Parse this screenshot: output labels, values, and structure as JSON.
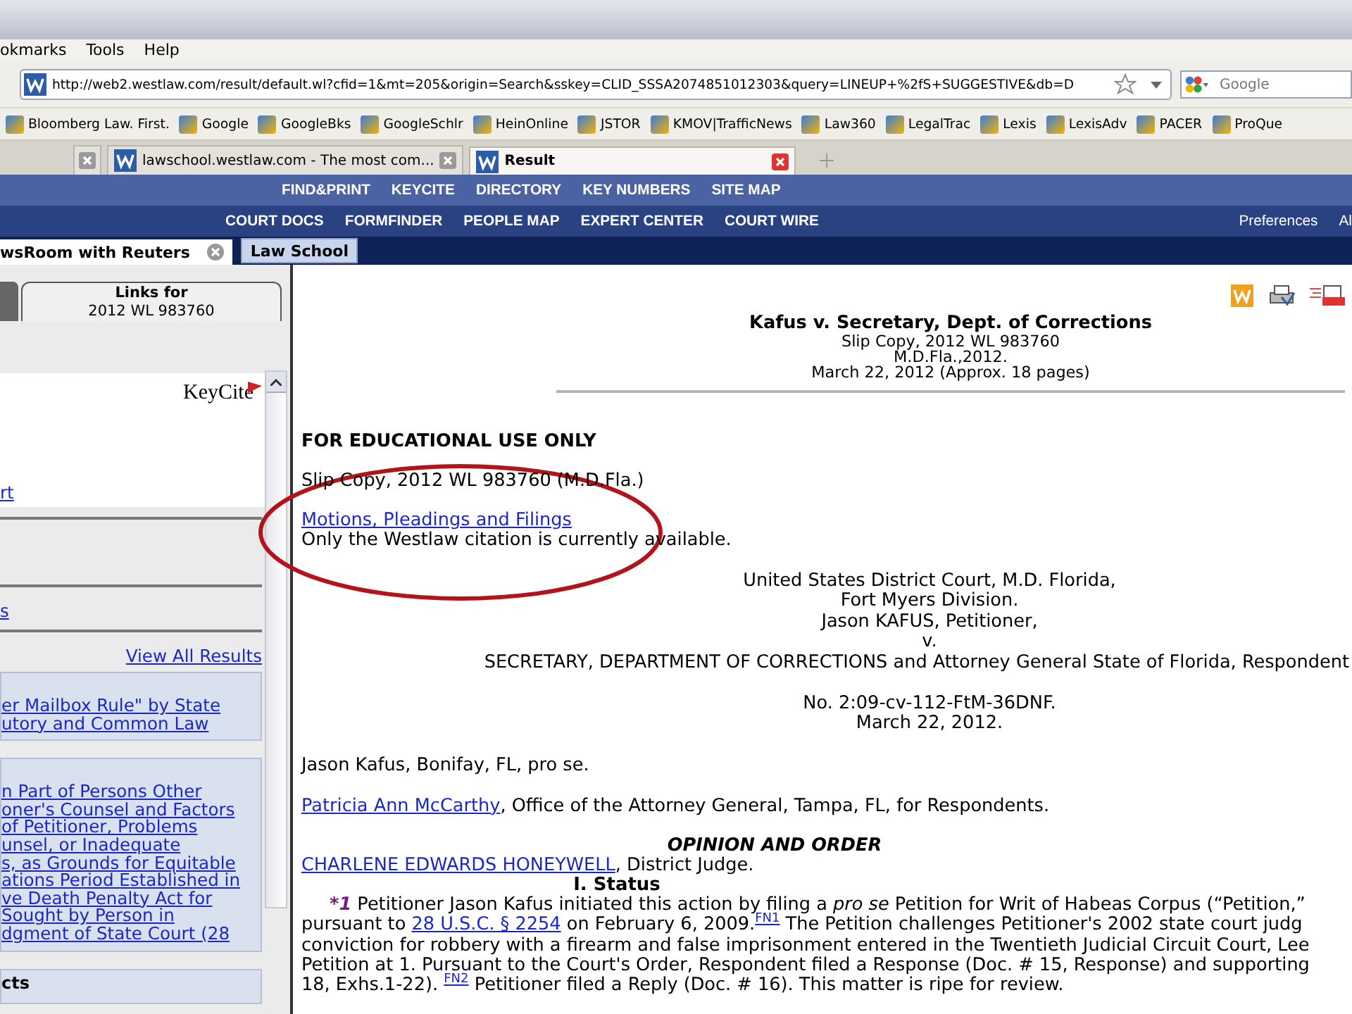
{
  "browser": {
    "menu": [
      "okmarks",
      "Tools",
      "Help"
    ],
    "url": "http://web2.westlaw.com/result/default.wl?cfid=1&mt=205&origin=Search&sskey=CLID_SSSA2074851012303&query=LINEUP+%2fS+SUGGESTIVE&db=D",
    "search_placeholder": "Google",
    "bookmarks": [
      "Bloomberg Law. First.",
      "Google",
      "GoogleBks",
      "GoogleSchlr",
      "HeinOnline",
      "JSTOR",
      "KMOV|TrafficNews",
      "Law360",
      "LegalTrac",
      "Lexis",
      "LexisAdv",
      "PACER",
      "ProQue"
    ],
    "tabs": [
      {
        "selected": false
      },
      {
        "label": "lawschool.westlaw.com - The most com...",
        "selected": false
      },
      {
        "label": "Result",
        "selected": true
      }
    ]
  },
  "site": {
    "nav_primary": [
      "FIND&PRINT",
      "KEYCITE",
      "DIRECTORY",
      "KEY NUMBERS",
      "SITE MAP"
    ],
    "nav_secondary": [
      "COURT DOCS",
      "FORMFINDER",
      "PEOPLE MAP",
      "EXPERT CENTER",
      "COURT WIRE"
    ],
    "nav_right": [
      "Preferences",
      "Al"
    ],
    "tabs": [
      {
        "label": "wsRoom with Reuters",
        "closable": true
      },
      {
        "label": "Law School",
        "closable": false
      }
    ]
  },
  "sidebar": {
    "tab_title": "Links for",
    "tab_subtitle": "2012 WL 983760",
    "logo": "KeyCite",
    "link_1": "rt",
    "link_2": "s",
    "view_all": "View All Results",
    "result_boxes": [
      {
        "lines": [
          "er Mailbox Rule\" by State",
          "utory and Common Law"
        ]
      },
      {
        "lines": [
          "n Part of Persons Other",
          "oner's Counsel and Factors",
          "of Petitioner, Problems",
          "unsel, or Inadequate",
          "s, as Grounds for Equitable",
          "ations Period Established in",
          "ve Death Penalty Act for",
          "Sought by Person in",
          "dgment of State Court (28"
        ]
      }
    ],
    "bottom_heading": "cts"
  },
  "document": {
    "title": "Kafus v. Secretary, Dept. of Corrections",
    "header_lines": [
      "Slip Copy, 2012 WL 983760",
      "M.D.Fla.,2012.",
      "March 22, 2012 (Approx. 18 pages)"
    ],
    "notice": "FOR EDUCATIONAL USE ONLY",
    "citation": "Slip Copy, 2012 WL 983760 (M.D.Fla.)",
    "filings_link": "Motions, Pleadings and Filings",
    "filings_note": "Only the Westlaw citation is currently available.",
    "court_lines": [
      {
        "text": "United States District Court, M.D. Florida,",
        "kind": "center"
      },
      {
        "text": "Fort Myers Division.",
        "kind": "center"
      },
      {
        "text": "Jason KAFUS, Petitioner,",
        "kind": "center"
      },
      {
        "text": "v.",
        "kind": "center"
      },
      {
        "text": "SECRETARY, DEPARTMENT OF CORRECTIONS and Attorney General State of Florida, Respondent",
        "kind": "wide"
      }
    ],
    "docket_lines": [
      "No. 2:09-cv-112-FtM-36DNF.",
      "March 22, 2012."
    ],
    "petitioner_counsel": "Jason Kafus, Bonifay, FL, pro se.",
    "respondent_counsel": [
      {
        "kind": "link",
        "text": "Patricia Ann McCarthy"
      },
      {
        "kind": "text",
        "text": ", Office of the Attorney General, Tampa, FL, for Respondents."
      }
    ],
    "opinion_heading": "OPINION AND ORDER",
    "judge": [
      {
        "kind": "link",
        "text": "CHARLENE EDWARDS HONEYWELL"
      },
      {
        "kind": "text",
        "text": ", District Judge."
      }
    ],
    "section_heading": "I. Status",
    "paragraph_lines": [
      [
        {
          "kind": "star",
          "text": "*1"
        },
        {
          "kind": "text",
          "text": " Petitioner Jason Kafus initiated this action by filing a "
        },
        {
          "kind": "italic",
          "text": "pro se"
        },
        {
          "kind": "text",
          "text": " Petition for Writ of Habeas Corpus (“Petition,”"
        }
      ],
      [
        {
          "kind": "text",
          "text": "pursuant to "
        },
        {
          "kind": "link",
          "text": "28 U.S.C. § 2254"
        },
        {
          "kind": "text",
          "text": " on February 6, 2009."
        },
        {
          "kind": "footnote",
          "text": "FN1"
        },
        {
          "kind": "text",
          "text": " The Petition challenges Petitioner's 2002 state court judg"
        }
      ],
      [
        {
          "kind": "text",
          "text": "conviction for robbery with a firearm and false imprisonment entered in the Twentieth Judicial Circuit Court, Lee"
        }
      ],
      [
        {
          "kind": "text",
          "text": "Petition at 1. Pursuant to the Court's Order, Respondent filed a Response (Doc. # 15, Response) and supporting"
        }
      ],
      [
        {
          "kind": "text",
          "text": "18, Exhs.1-22). "
        },
        {
          "kind": "footnote",
          "text": "FN2"
        },
        {
          "kind": "text",
          "text": " Petitioner filed a Reply (Doc. # 16). This matter is ripe for review."
        }
      ]
    ]
  }
}
